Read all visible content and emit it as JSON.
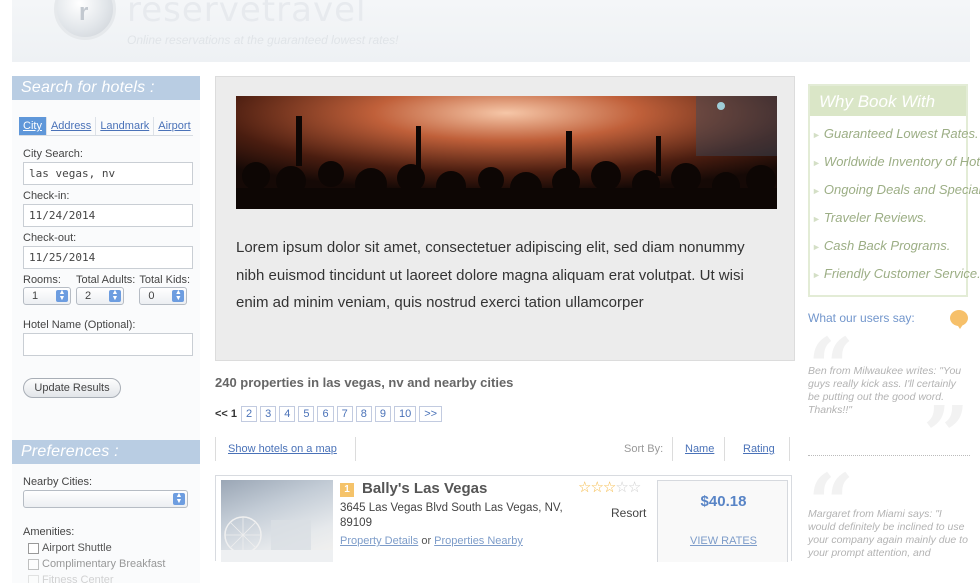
{
  "header": {
    "brand": "reservetravel",
    "logo_letter": "r",
    "tagline": "Online reservations at the guaranteed lowest rates!"
  },
  "search": {
    "title": "Search for hotels :",
    "tabs": [
      "City",
      "Address",
      "Landmark",
      "Airport"
    ],
    "active_tab": "City",
    "city_label": "City Search:",
    "city_value": "las vegas, nv",
    "checkin_label": "Check-in:",
    "checkin_value": "11/24/2014",
    "checkout_label": "Check-out:",
    "checkout_value": "11/25/2014",
    "rooms_label": "Rooms:",
    "rooms_value": "1",
    "adults_label": "Total Adults:",
    "adults_value": "2",
    "kids_label": "Total Kids:",
    "kids_value": "0",
    "hotel_name_label": "Hotel Name (Optional):",
    "hotel_name_value": "",
    "update_button": "Update Results"
  },
  "preferences": {
    "title": "Preferences :",
    "nearby_label": "Nearby Cities:",
    "nearby_value": "",
    "amenities_label": "Amenities:",
    "amenities": [
      "Airport Shuttle",
      "Complimentary Breakfast",
      "Fitness Center"
    ]
  },
  "hero": {
    "text": "Lorem ipsum dolor sit amet, consectetuer adipiscing elit, sed diam nonummy nibh euismod tincidunt ut laoreet dolore magna aliquam erat volutpat. Ut wisi enim ad minim veniam, quis nostrud exerci tation ullamcorper"
  },
  "results": {
    "count_text": "240 properties in las vegas, nv and nearby cities",
    "pager": {
      "prev": "<<",
      "current": "1",
      "pages": [
        "2",
        "3",
        "4",
        "5",
        "6",
        "7",
        "8",
        "9",
        "10"
      ],
      "next": ">>"
    },
    "show_map": "Show hotels on a map",
    "sort_by": "Sort By:",
    "sort_name": "Name",
    "sort_rating": "Rating"
  },
  "hotel": {
    "rank": "1",
    "name": "Bally's Las Vegas",
    "rating": 3,
    "max_rating": 5,
    "address": "3645 Las Vegas Blvd South Las Vegas, NV, 89109",
    "type": "Resort",
    "link_details": "Property Details",
    "link_or": "or",
    "link_nearby": "Properties Nearby",
    "price": "$40.18",
    "view_rates": "VIEW RATES"
  },
  "why_book": {
    "title": "Why Book With Us?",
    "items": [
      "Guaranteed Lowest Rates.",
      "Worldwide Inventory of Hotels.",
      "Ongoing Deals and Specials.",
      "Traveler Reviews.",
      "Cash Back Programs.",
      "Friendly Customer Service."
    ]
  },
  "testimonials": {
    "title": "What our users say:",
    "items": [
      "Ben from Milwaukee writes: \"You guys really kick ass. I'll certainly be putting out the good word. Thanks!!\"",
      "Margaret from Miami says: \"I would definitely be inclined to use your company again mainly due to your prompt attention, and"
    ]
  },
  "colors": {
    "panel_blue": "#b9cde3",
    "link_blue": "#4a72b8",
    "green_head": "#dae6c7",
    "star": "#f5b945"
  }
}
